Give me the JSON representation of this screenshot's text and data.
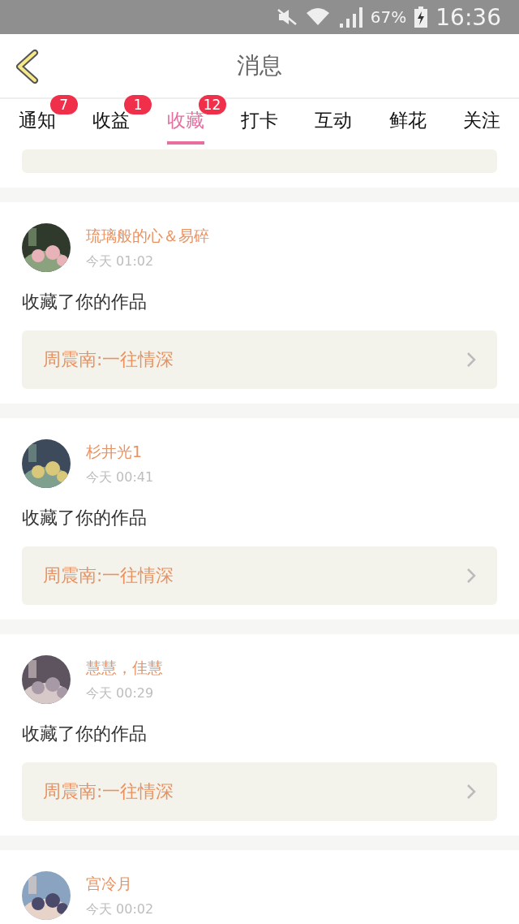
{
  "status_bar": {
    "battery": "67%",
    "time": "16:36"
  },
  "header": {
    "title": "消息"
  },
  "tabs": [
    {
      "label": "通知",
      "badge": "7",
      "selected": false
    },
    {
      "label": "收益",
      "badge": "1",
      "selected": false
    },
    {
      "label": "收藏",
      "badge": "12",
      "selected": true
    },
    {
      "label": "打卡",
      "selected": false
    },
    {
      "label": "互动",
      "selected": false
    },
    {
      "label": "鲜花",
      "selected": false
    },
    {
      "label": "关注",
      "selected": false
    }
  ],
  "messages": [
    {
      "kind": "partial"
    },
    {
      "kind": "full",
      "user": "琉璃般的心＆易碎",
      "time": "今天 01:02",
      "text": "收藏了你的作品",
      "work": "周震南:一往情深"
    },
    {
      "kind": "full",
      "user": "杉井光1",
      "time": "今天 00:41",
      "text": "收藏了你的作品",
      "work": "周震南:一往情深"
    },
    {
      "kind": "full",
      "user": "慧慧，佳慧",
      "time": "今天 00:29",
      "text": "收藏了你的作品",
      "work": "周震南:一往情深"
    },
    {
      "kind": "full",
      "user": "宫冷月",
      "time": "今天 00:02"
    }
  ]
}
